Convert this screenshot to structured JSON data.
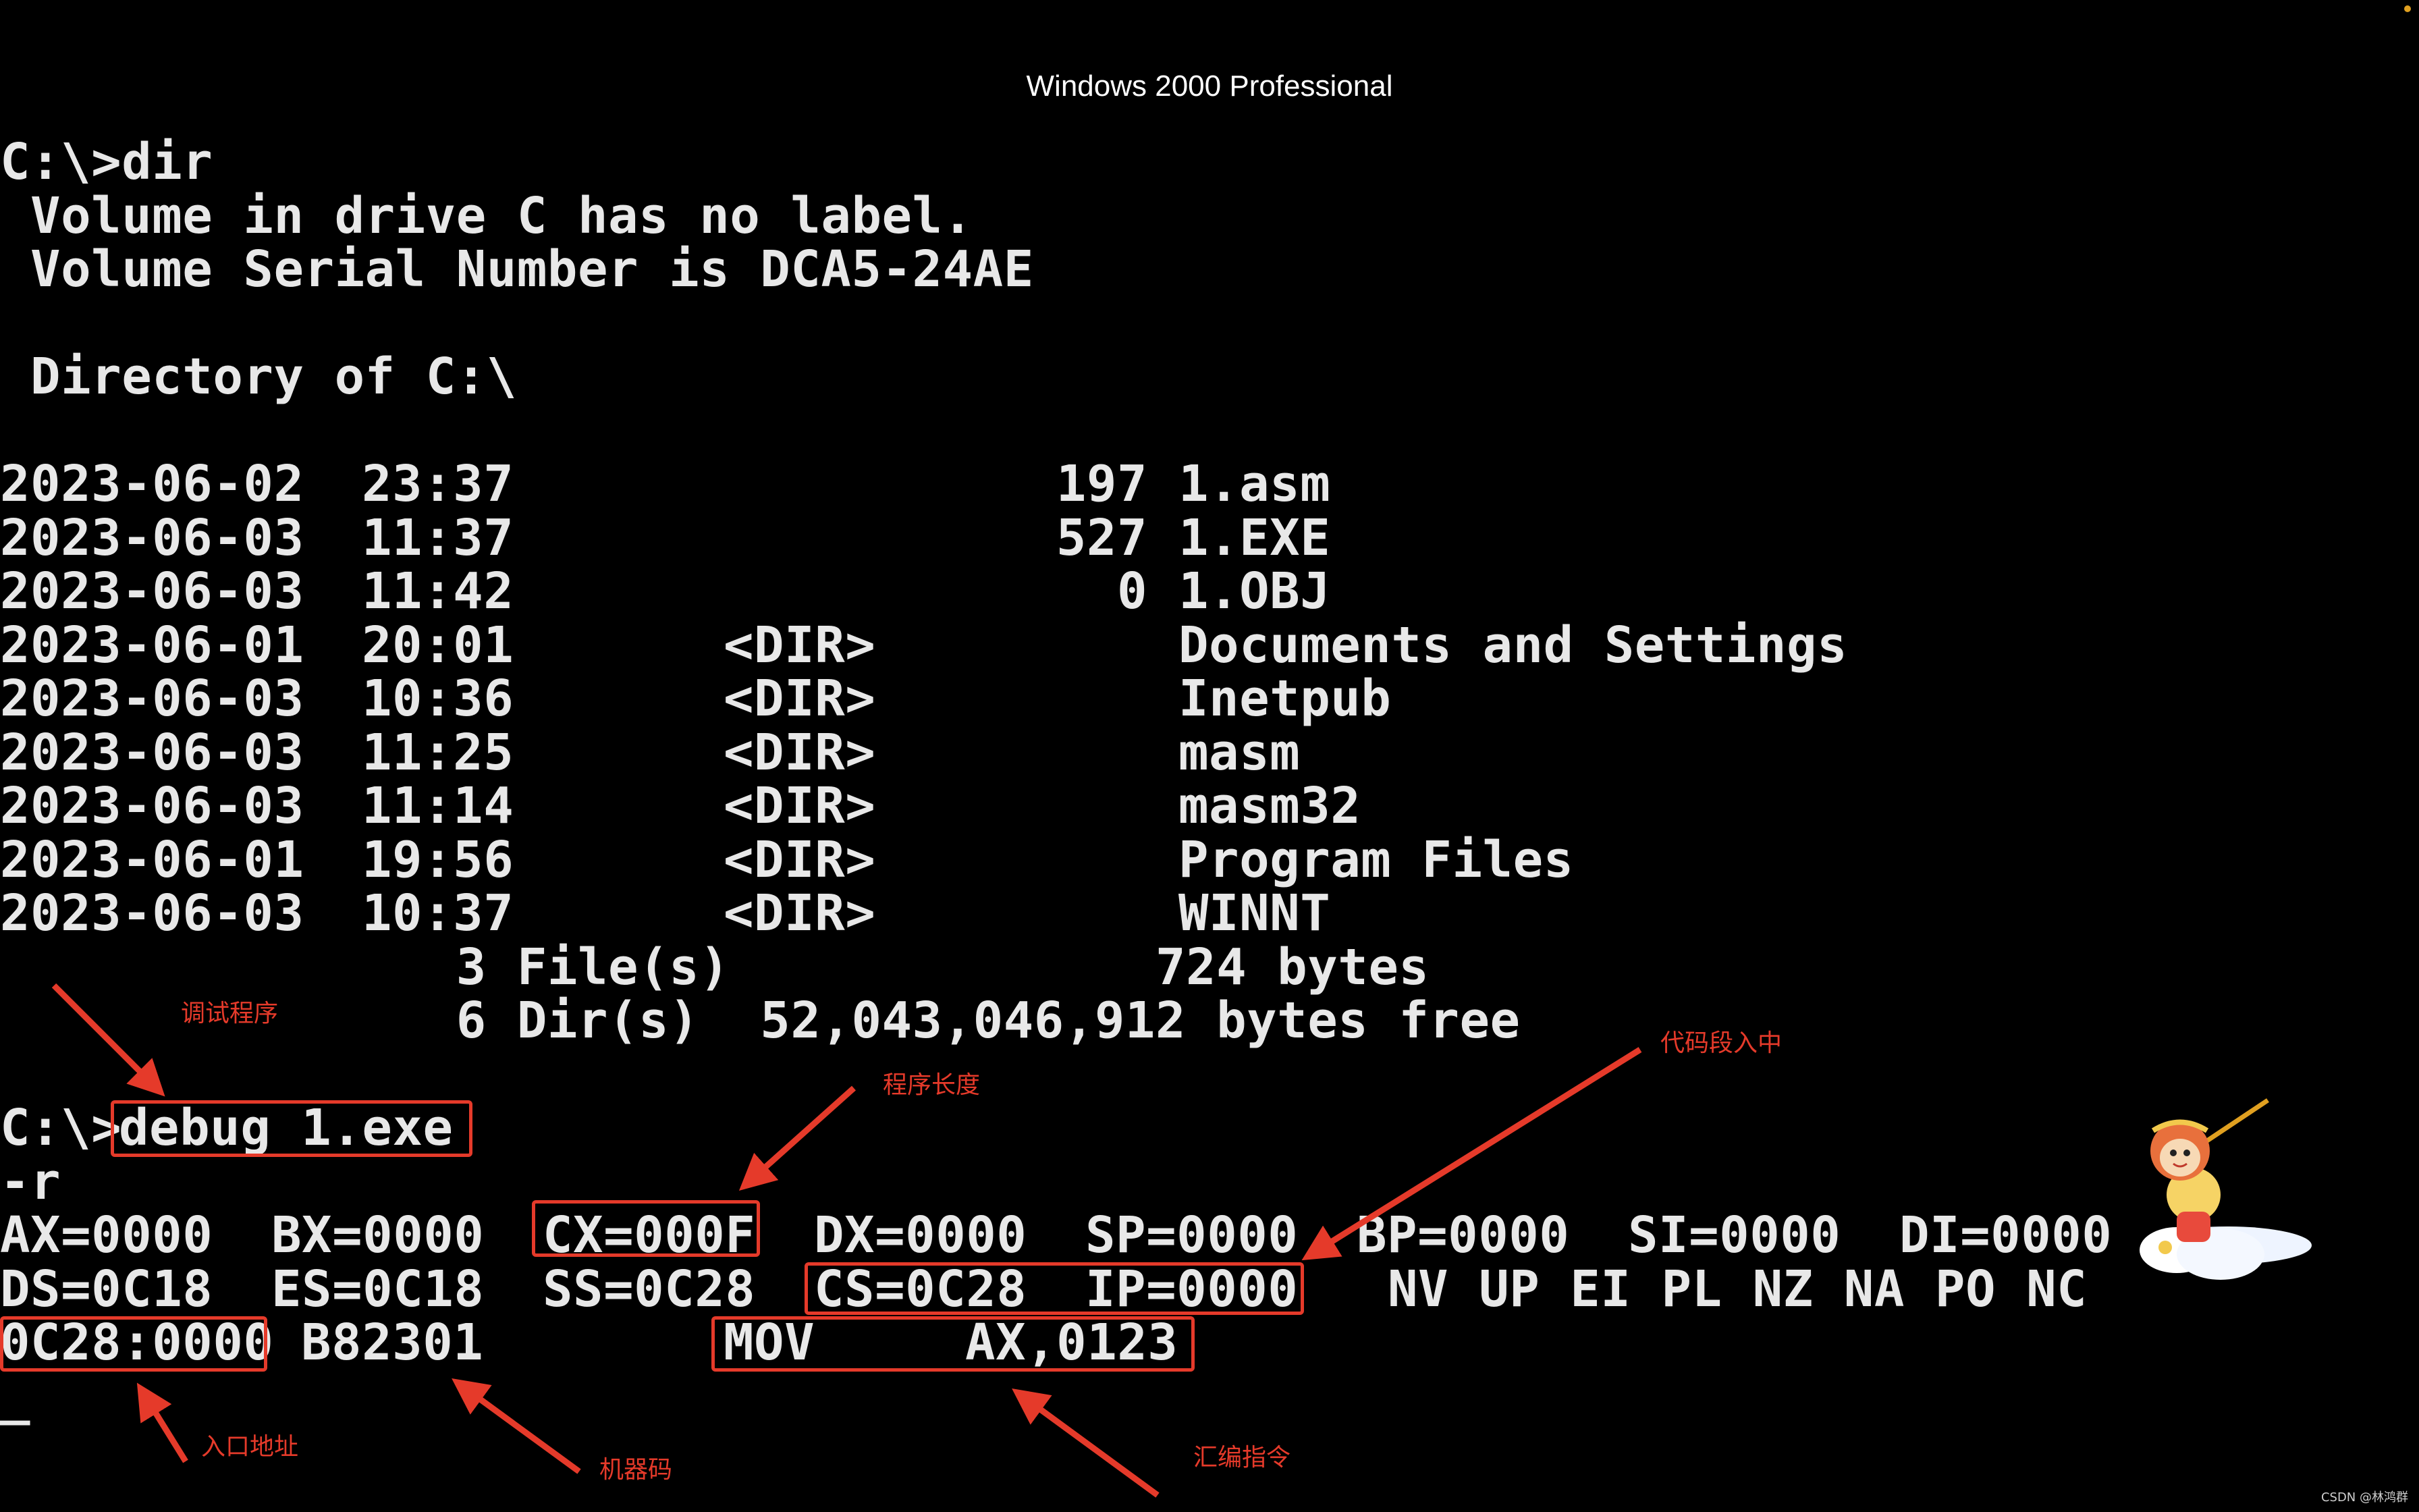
{
  "window": {
    "title": "Windows 2000 Professional"
  },
  "console": {
    "prompt_dir": "C:\\>dir",
    "volume_label": " Volume in drive C has no label.",
    "volume_serial": " Volume Serial Number is DCA5-24AE",
    "blank1": "",
    "directory_of": " Directory of C:\\",
    "blank2": "",
    "entries": [
      {
        "date": "2023-06-02",
        "time": "23:37",
        "type": "",
        "size": "197",
        "name": "1.asm"
      },
      {
        "date": "2023-06-03",
        "time": "11:37",
        "type": "",
        "size": "527",
        "name": "1.EXE"
      },
      {
        "date": "2023-06-03",
        "time": "11:42",
        "type": "",
        "size": "0",
        "name": "1.OBJ"
      },
      {
        "date": "2023-06-01",
        "time": "20:01",
        "type": "<DIR>",
        "size": "",
        "name": "Documents and Settings"
      },
      {
        "date": "2023-06-03",
        "time": "10:36",
        "type": "<DIR>",
        "size": "",
        "name": "Inetpub"
      },
      {
        "date": "2023-06-03",
        "time": "11:25",
        "type": "<DIR>",
        "size": "",
        "name": "masm"
      },
      {
        "date": "2023-06-03",
        "time": "11:14",
        "type": "<DIR>",
        "size": "",
        "name": "masm32"
      },
      {
        "date": "2023-06-01",
        "time": "19:56",
        "type": "<DIR>",
        "size": "",
        "name": "Program Files"
      },
      {
        "date": "2023-06-03",
        "time": "10:37",
        "type": "<DIR>",
        "size": "",
        "name": "WINNT"
      }
    ],
    "files_summary": "               3 File(s)              724 bytes",
    "dirs_summary": "               6 Dir(s)  52,043,046,912 bytes free",
    "blank3": "",
    "debug_prompt": "C:\\>",
    "debug_command": "debug 1.exe",
    "r_command": "-r",
    "registers": {
      "AX": "AX=0000",
      "BX": "BX=0000",
      "CX": "CX=000F",
      "DX": "DX=0000",
      "SP": "SP=0000",
      "BP": "BP=0000",
      "SI": "SI=0000",
      "DI": "DI=0000",
      "DS": "DS=0C18",
      "ES": "ES=0C18",
      "SS": "SS=0C28",
      "CS": "CS=0C28",
      "IP": "IP=0000",
      "flags": "NV UP EI PL NZ NA PO NC"
    },
    "instruction": {
      "address": "0C28:0000",
      "machine_code": "B82301",
      "mnemonic": "MOV",
      "operands": "AX,0123"
    },
    "cursor": "_"
  },
  "annotations": {
    "debug_program": "调试程序",
    "program_length": "程序长度",
    "in_code_segment": "代码段入中",
    "entry_address": "入口地址",
    "machine_code": "机器码",
    "assembly_instruction": "汇编指令",
    "color": "#e53a2a"
  },
  "watermark": "CSDN @林鸿群"
}
